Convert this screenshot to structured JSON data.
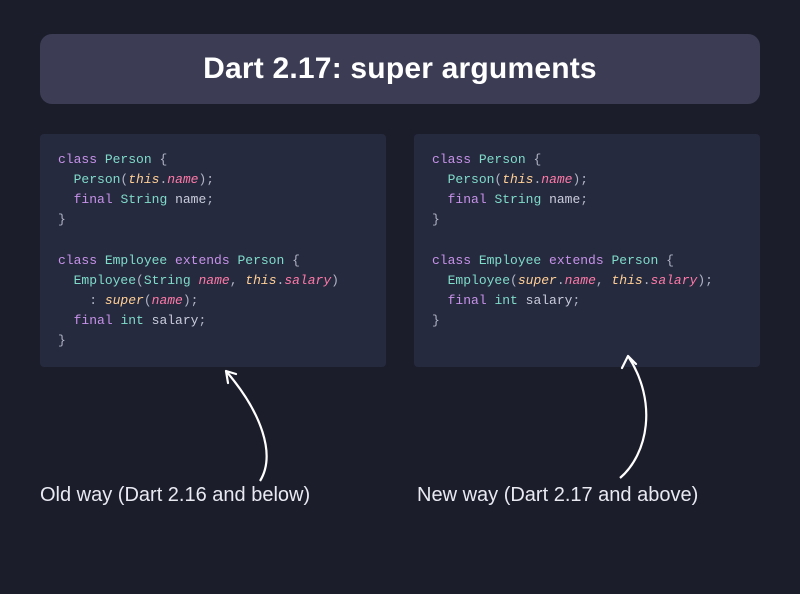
{
  "title": "Dart 2.17: super arguments",
  "left": {
    "caption": "Old way (Dart 2.16 and below)",
    "code": {
      "l1_kw": "class",
      "l1_type": "Person",
      "l1_brace": " {",
      "l2_indent": "  ",
      "l2_ctor": "Person",
      "l2_open": "(",
      "l2_this": "this",
      "l2_dot": ".",
      "l2_prop": "name",
      "l2_close": ");",
      "l3_indent": "  ",
      "l3_final": "final",
      "l3_sp": " ",
      "l3_type": "String",
      "l3_sp2": " ",
      "l3_prop": "name",
      "l3_semi": ";",
      "l4": "}",
      "l6_kw": "class",
      "l6_type": "Employee",
      "l6_ext": " extends ",
      "l6_type2": "Person",
      "l6_brace": " {",
      "l7_indent": "  ",
      "l7_ctor": "Employee",
      "l7_open": "(",
      "l7_ptype": "String",
      "l7_sp": " ",
      "l7_pname": "name",
      "l7_comma": ", ",
      "l7_this": "this",
      "l7_dot": ".",
      "l7_prop": "salary",
      "l7_close": ")",
      "l8_indent": "    ",
      "l8_colon": ": ",
      "l8_super": "super",
      "l8_open": "(",
      "l8_arg": "name",
      "l8_close": ");",
      "l9_indent": "  ",
      "l9_final": "final",
      "l9_sp": " ",
      "l9_type": "int",
      "l9_sp2": " ",
      "l9_prop": "salary",
      "l9_semi": ";",
      "l10": "}"
    }
  },
  "right": {
    "caption": "New way (Dart 2.17 and above)",
    "code": {
      "l1_kw": "class",
      "l1_type": "Person",
      "l1_brace": " {",
      "l2_indent": "  ",
      "l2_ctor": "Person",
      "l2_open": "(",
      "l2_this": "this",
      "l2_dot": ".",
      "l2_prop": "name",
      "l2_close": ");",
      "l3_indent": "  ",
      "l3_final": "final",
      "l3_sp": " ",
      "l3_type": "String",
      "l3_sp2": " ",
      "l3_prop": "name",
      "l3_semi": ";",
      "l4": "}",
      "l6_kw": "class",
      "l6_type": "Employee",
      "l6_ext": " extends ",
      "l6_type2": "Person",
      "l6_brace": " {",
      "l7_indent": "  ",
      "l7_ctor": "Employee",
      "l7_open": "(",
      "l7_super": "super",
      "l7_dot": ".",
      "l7_prop": "name",
      "l7_comma": ", ",
      "l7_this": "this",
      "l7_dot2": ".",
      "l7_prop2": "salary",
      "l7_close": ");",
      "l8_indent": "  ",
      "l8_final": "final",
      "l8_sp": " ",
      "l8_type": "int",
      "l8_sp2": " ",
      "l8_prop": "salary",
      "l8_semi": ";",
      "l9": "}"
    }
  }
}
